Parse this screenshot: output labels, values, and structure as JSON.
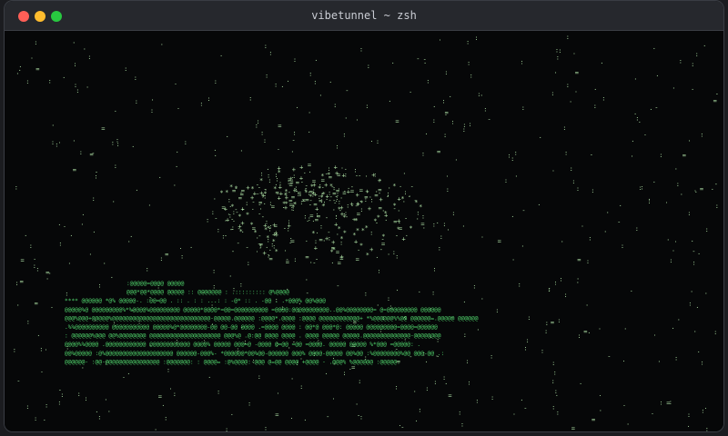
{
  "window": {
    "title": "vibetunnel ~ zsh",
    "controls": [
      "close",
      "minimize",
      "maximize"
    ]
  },
  "terminal": {
    "background": "#060708",
    "text_color": "#a9d9a0",
    "accent_green": "#4fd16a",
    "logo_lines": [
      ":@@@@@=@@@@                                                                                            @@@@@",
      "@@@*@@*@@@@   @@@@@   :: @@@@@@@  :  .:::::::::                                                       @%@@@@",
      "****  @@@@@@  *@%   @@@@@-.  :@@=@@  .  ::  .  : : ...:  :  -@* ::    .  -@@  .  .+@@@%     @@%@@@",
      "@@@@@%@  @@@@@@@@@%*%@@@@%@@@@@@@@@  @@@@@*@@@@*=@@=@@@@@@@@@@  =@@@@:@@@@@@@@@@@..@@%@@@@@@@@=  @=@@@@@@@@@  @@@@@@",
      "@@@%@@@+@@@@@%@@@@@@@@@@@@@@@@@@@@@@@@@@@@@-@@@@@.@@@@@@ :@@@@*.@@@@  :@@@@  @@@@@@@@@@@@+  *%@@@@@@%%@@ @@@@@@=.@@@@@ @@@@@@",
      ".%%@@@@@@@@@@ @@@@@@@@@@@   @@@@@%@*@@@@@@@@-@@  @@-@@  @@@@  .=@@@@ @@@@ :  @@*@ @@@*@:  @@@@@ @@@@@@@@@=@@@@=@@@@@@",
      ": @@@@@@%@@@  @@%@@@@@@@@    @@@@@@@@@@@@@@@@@@@@@  @@@%@  .@:@@  @@@@ @@@@  . @@@@ @@@@@    @@@@@.@@@@@@@@@@@@@@-@@@@@@@@",
      "@@@@%%@@@@ .@@@@@@@@@@@@  @@@@@@@@@@@@    @@@@%   @@@@@  @@@=@   -@@@@ @=@@  =@@ =@@@@. @@@@@ @@@@@    %*@@@ =@@@@@: .",
      "@@%@@@@@  :@%@@@@@@@@@@@@@@@@@@@@  @@@@@@-@@@%-   *@@@@@@*@@%@@-@@@@@@ @@@%    @@@@-@@@@@   @@%@@ :%@@@@@@@@%@@ @@@-@@ .:",
      "@@@@@@-   :@@-@@@@@@@@@@@@@@@@    :@@@@@@@: :   @@@@=  :@%@@@@:-@@@ @=@@    @@@@ +@@@@ - .@@@%     %@@@@@@     :@@@@@:"
    ],
    "glyphs": [
      ".",
      ":",
      "-",
      "=",
      "+",
      "*",
      "%",
      "@",
      "~",
      "'"
    ]
  }
}
